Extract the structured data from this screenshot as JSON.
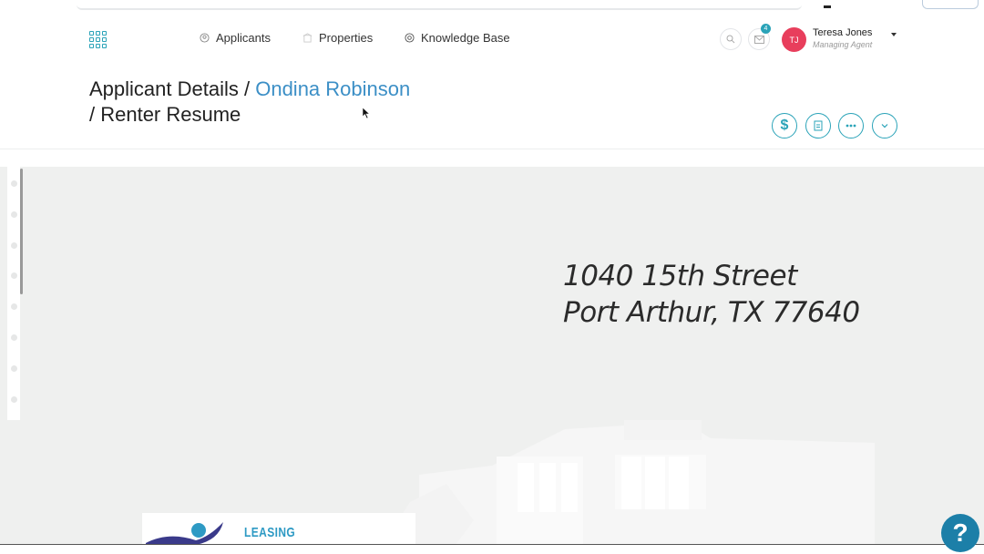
{
  "nav": {
    "items": [
      {
        "label": "Applicants",
        "icon": "user-circle-icon"
      },
      {
        "label": "Properties",
        "icon": "building-icon"
      },
      {
        "label": "Knowledge Base",
        "icon": "lifebuoy-icon"
      }
    ]
  },
  "header": {
    "notifications_count": "4",
    "user": {
      "initials": "TJ",
      "name": "Teresa Jones",
      "role": "Managing Agent"
    }
  },
  "page": {
    "title_prefix": "Applicant Details /",
    "applicant_name": "Ondina Robinson",
    "title_suffix": "/ Renter Resume"
  },
  "actions": [
    {
      "name": "payment-button",
      "icon": "dollar-icon"
    },
    {
      "name": "document-button",
      "icon": "document-icon"
    },
    {
      "name": "more-button",
      "icon": "ellipsis-icon"
    },
    {
      "name": "expand-button",
      "icon": "chevron-down-icon"
    }
  ],
  "document": {
    "address_line1": "1040 15th Street",
    "address_line2": "Port Arthur, TX 77640",
    "brand_text": "LEASING"
  },
  "help": {
    "label": "?"
  },
  "colors": {
    "accent": "#2aa3b8",
    "link": "#3c8fc6",
    "avatar": "#e83e5c",
    "help": "#1c7fa8"
  }
}
